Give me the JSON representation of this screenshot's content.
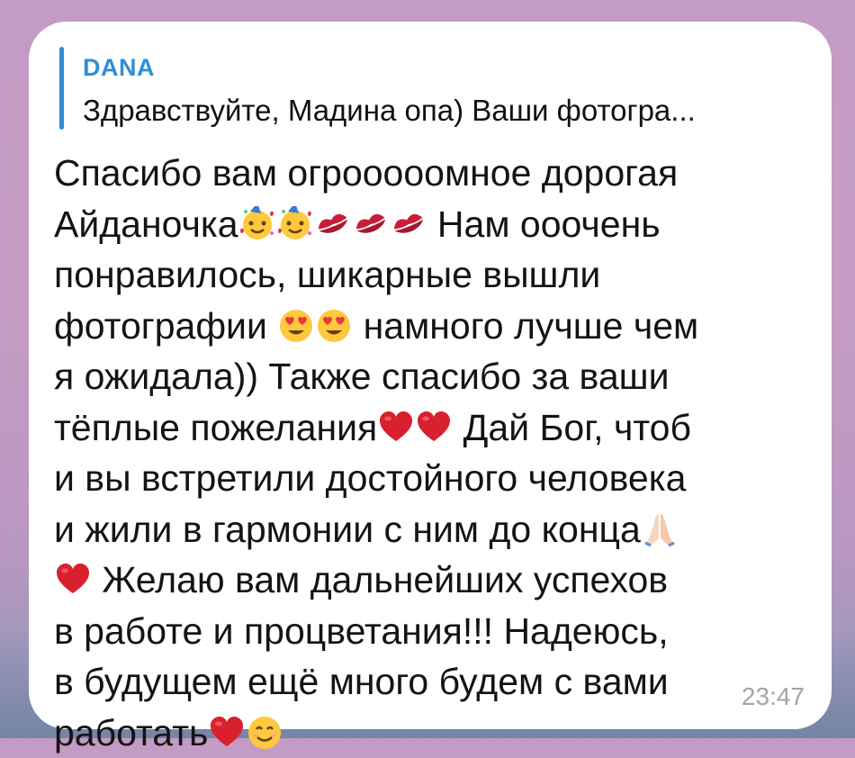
{
  "reply": {
    "author": "DANA",
    "preview": "Здравствуйте, Мадина опа)  Ваши фотогра..."
  },
  "message": {
    "line1": "Спасибо вам огрооооомное дорогая",
    "line2a": "Айданочка",
    "line2b": " Нам ооочень",
    "line3": "понравилось, шикарные вышли",
    "line4a": "фотографии ",
    "line4b": " намного лучше чем",
    "line5": "я ожидала)) Также спасибо за ваши",
    "line6a": "тёплые пожелания",
    "line6b": " Дай Бог, чтоб",
    "line7": "и вы встретили достойного человека",
    "line8": "и жили в гармонии с ним до конца",
    "line9": " Желаю вам дальнейших успехов",
    "line10": "в работе и процветания!!! Надеюсь,",
    "line11": "в будущем ещё много будем с вами",
    "line12": "работать"
  },
  "emojis": {
    "party_face": "smiling-face-with-hearts-party",
    "kiss": "kiss-mark",
    "heart_eyes": "smiling-face-with-heart-eyes",
    "heart": "red-heart",
    "pray": "folded-hands",
    "smile": "smiling-face-with-smiling-eyes"
  },
  "timestamp": "23:47",
  "colors": {
    "accent": "#2e8fd6",
    "bubble": "#ffffff",
    "heart": "#d8202f",
    "kiss": "#c81e3c",
    "emoji_face": "#ffc83d",
    "timestamp": "#a4a4a4"
  }
}
